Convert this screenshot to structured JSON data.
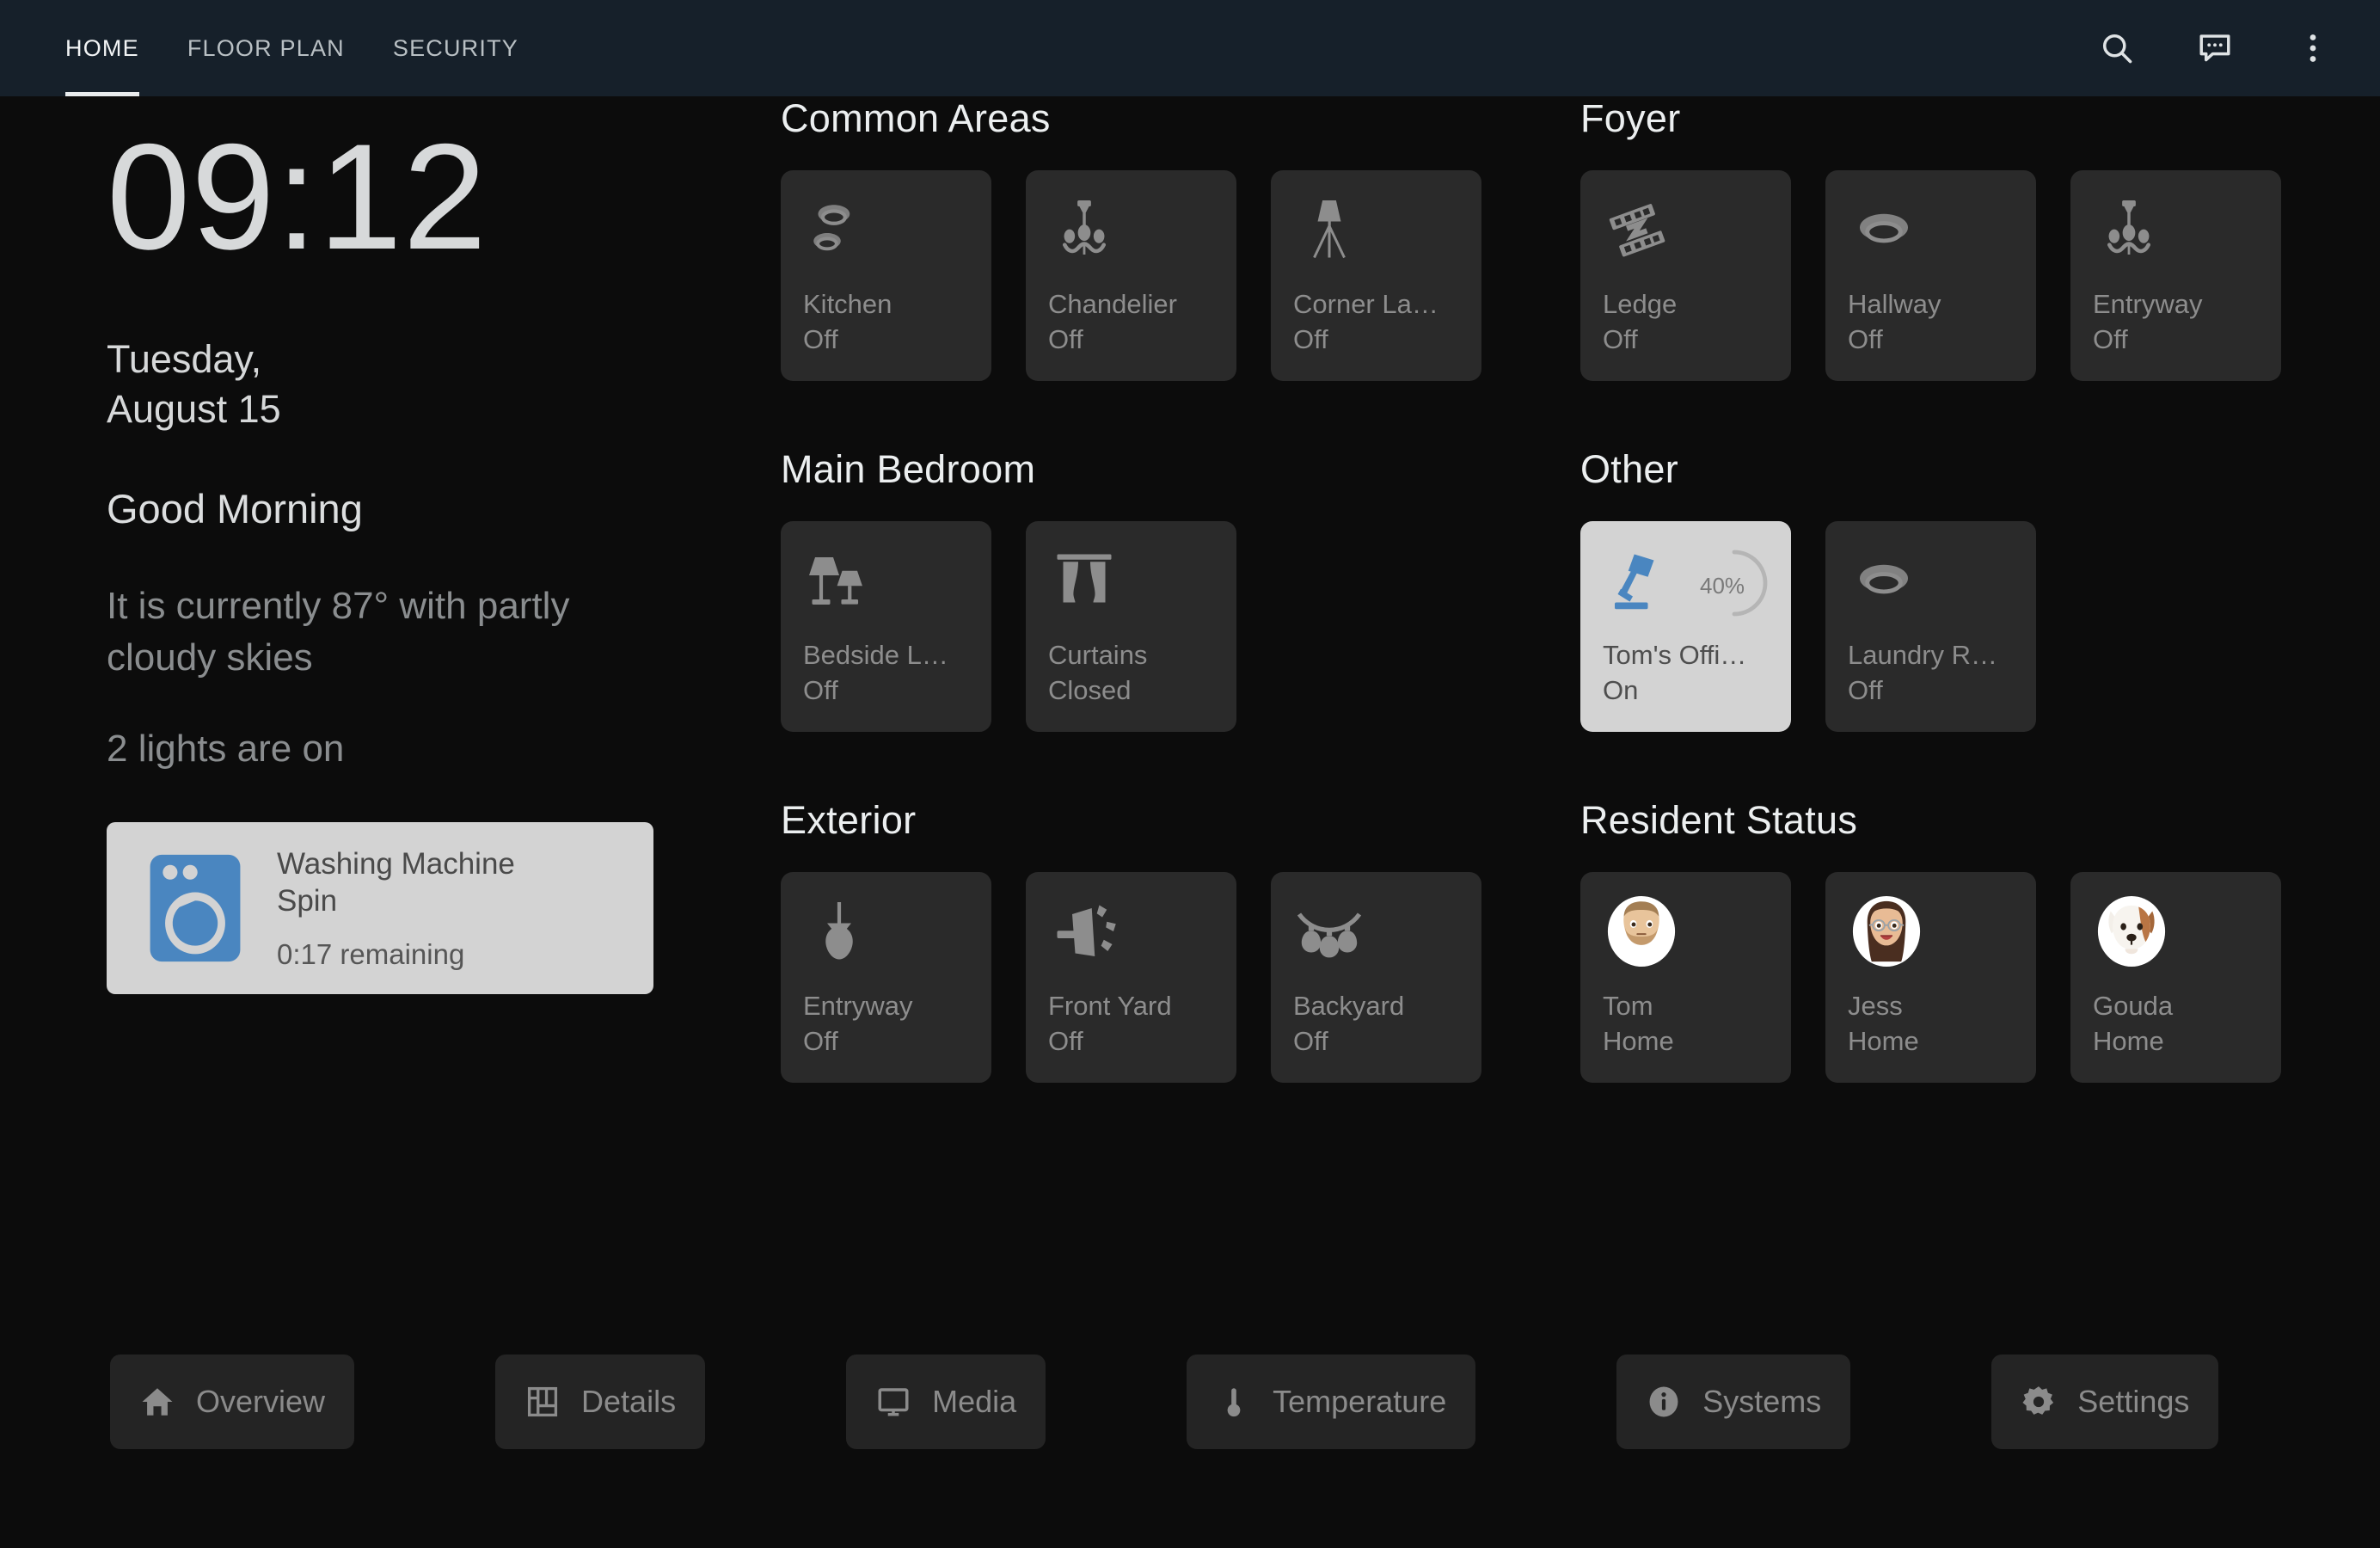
{
  "appbar": {
    "tabs": [
      {
        "label": "HOME",
        "active": true
      },
      {
        "label": "FLOOR PLAN",
        "active": false
      },
      {
        "label": "SECURITY",
        "active": false
      }
    ],
    "actions": [
      {
        "icon": "search-icon"
      },
      {
        "icon": "chat-bubble-icon"
      },
      {
        "icon": "overflow-menu-icon"
      }
    ]
  },
  "left": {
    "time": "09:12",
    "day": "Tuesday,",
    "date": "August 15",
    "greeting": "Good Morning",
    "weather": "It is currently 87° with partly cloudy skies",
    "lights_summary": "2 lights are on",
    "appliance": {
      "icon": "washing-machine-icon",
      "name": "Washing Machine",
      "mode": "Spin",
      "remaining": "0:17 remaining",
      "accent": "#4a86c0",
      "card_bg": "#d3d3d3"
    }
  },
  "sections": [
    {
      "title": "Common Areas",
      "tiles": [
        {
          "icon": "ceiling-lights-icon",
          "name": "Kitchen",
          "state": "Off",
          "on": false
        },
        {
          "icon": "chandelier-icon",
          "name": "Chandelier",
          "state": "Off",
          "on": false
        },
        {
          "icon": "floor-lamp-icon",
          "name": "Corner La…",
          "state": "Off",
          "on": false
        }
      ]
    },
    {
      "title": "Foyer",
      "tiles": [
        {
          "icon": "led-strip-icon",
          "name": "Ledge",
          "state": "Off",
          "on": false
        },
        {
          "icon": "ceiling-light-icon",
          "name": "Hallway",
          "state": "Off",
          "on": false
        },
        {
          "icon": "chandelier-icon",
          "name": "Entryway",
          "state": "Off",
          "on": false
        }
      ]
    },
    {
      "title": "Main Bedroom",
      "tiles": [
        {
          "icon": "table-lamps-icon",
          "name": "Bedside L…",
          "state": "Off",
          "on": false
        },
        {
          "icon": "curtains-icon",
          "name": "Curtains",
          "state": "Closed",
          "on": false
        }
      ]
    },
    {
      "title": "Other",
      "tiles": [
        {
          "icon": "desk-lamp-icon",
          "name": "Tom's Offi…",
          "state": "On",
          "on": true,
          "brightness": "40%",
          "brightness_value": 40
        },
        {
          "icon": "ceiling-light-icon",
          "name": "Laundry R…",
          "state": "Off",
          "on": false
        }
      ]
    },
    {
      "title": "Exterior",
      "tiles": [
        {
          "icon": "pendant-lamp-icon",
          "name": "Entryway",
          "state": "Off",
          "on": false
        },
        {
          "icon": "floodlight-icon",
          "name": "Front Yard",
          "state": "Off",
          "on": false
        },
        {
          "icon": "string-lights-icon",
          "name": "Backyard",
          "state": "Off",
          "on": false
        }
      ]
    },
    {
      "title": "Resident Status",
      "tiles": [
        {
          "icon": "avatar-tom",
          "name": "Tom",
          "state": "Home",
          "on": false
        },
        {
          "icon": "avatar-jess",
          "name": "Jess",
          "state": "Home",
          "on": false
        },
        {
          "icon": "avatar-gouda",
          "name": "Gouda",
          "state": "Home",
          "on": false
        }
      ]
    }
  ],
  "toolbar": [
    {
      "icon": "home-icon",
      "label": "Overview"
    },
    {
      "icon": "floorplan-icon",
      "label": "Details"
    },
    {
      "icon": "monitor-icon",
      "label": "Media"
    },
    {
      "icon": "thermometer-icon",
      "label": "Temperature"
    },
    {
      "icon": "info-icon",
      "label": "Systems"
    },
    {
      "icon": "gear-icon",
      "label": "Settings"
    }
  ]
}
